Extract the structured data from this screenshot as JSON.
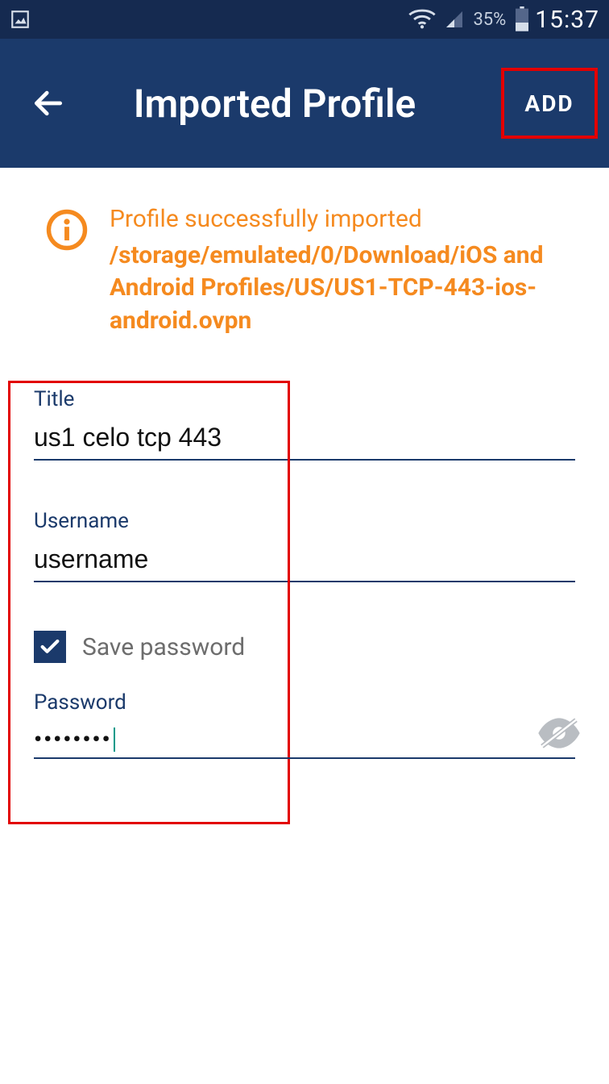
{
  "statusbar": {
    "battery_text": "35%",
    "time": "15:37"
  },
  "appbar": {
    "title": "Imported Profile",
    "add_label": "ADD"
  },
  "notice": {
    "heading": "Profile successfully imported",
    "path": "/storage/emulated/0/Download/iOS and Android Profiles/US/US1-TCP-443-ios-android.ovpn"
  },
  "form": {
    "title_label": "Title",
    "title_value": "us1 celo tcp 443",
    "username_label": "Username",
    "username_value": "username",
    "save_password_label": "Save password",
    "save_password_checked": true,
    "password_label": "Password",
    "password_masked": "••••••••"
  }
}
